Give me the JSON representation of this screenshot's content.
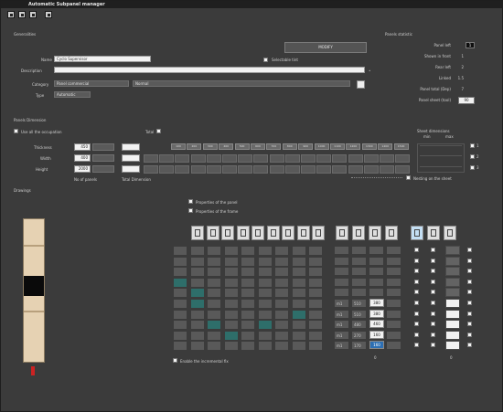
{
  "window": {
    "title": "Automatic Subpanel manager"
  },
  "general": {
    "heading": "Generalities",
    "name_label": "Name",
    "name_value": "Cyclo Supervisor",
    "visible_label": "Selectable tint",
    "description_label": "Description",
    "description_value": "",
    "category_label": "Category",
    "category_value": "Panel commercial",
    "category_value2": "Normal",
    "type_label": "Type",
    "type_value": "Automatic",
    "button_label": "MODIFY"
  },
  "summary": {
    "heading": "Panels statistic",
    "rows": [
      {
        "label": "Panel left",
        "value": "1"
      },
      {
        "label": "Shown in front",
        "value": "1"
      },
      {
        "label": "Rear left",
        "value": "2"
      },
      {
        "label": "Linked",
        "value": "1.5"
      },
      {
        "label": "Panel total (Dep)",
        "value": "7"
      },
      {
        "label": "Panel sheet (tool)",
        "value": "90"
      }
    ]
  },
  "panel_values": {
    "heading": "Panels Dimension",
    "use_all_label": "Use all the occupation",
    "total_label": "Total",
    "rows": [
      {
        "label": "Thickness",
        "value": "450"
      },
      {
        "label": "Width",
        "value": "400"
      },
      {
        "label": "Height",
        "value": "2000"
      }
    ],
    "col_a_label": "No of panels",
    "col_b_label": "Total Dimension",
    "grid_header": [
      "100",
      "200",
      "300",
      "400",
      "500",
      "600",
      "700",
      "800",
      "900",
      "1000",
      "1100",
      "1200",
      "1300",
      "1400",
      "1500"
    ],
    "extra_heading": "Sheet dimensions",
    "extra_cols": [
      "min",
      "max"
    ],
    "extra_checks": [
      "1",
      "2",
      "3"
    ],
    "dots_label": "Nesting on the sheet"
  },
  "drawing": {
    "heading": "Drawings",
    "opt1": "Properties of the panel",
    "opt2": "Properties of the frame",
    "footer_check": "Enable the incremental fix",
    "value_rows": [
      {
        "a": "m1",
        "b": "510",
        "c": "380"
      },
      {
        "a": "m1",
        "b": "510",
        "c": "380"
      },
      {
        "a": "m1",
        "b": "480",
        "c": "460"
      },
      {
        "a": "m1",
        "b": "270",
        "c": "160"
      },
      {
        "a": "m1",
        "b": "170",
        "c": "160"
      }
    ],
    "marker_left": "0",
    "marker_right": "0"
  }
}
